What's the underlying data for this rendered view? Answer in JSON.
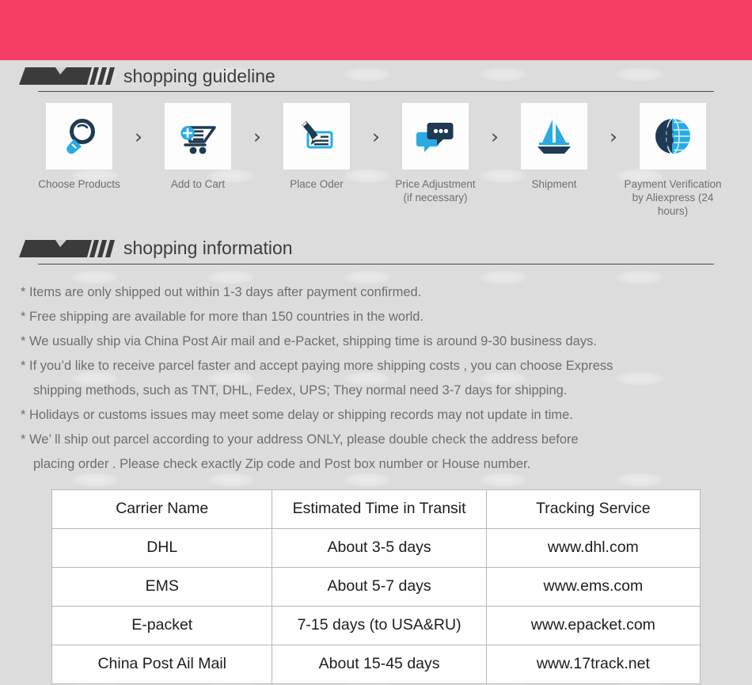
{
  "banner": {
    "color": "#f53e64"
  },
  "sections": {
    "guideline": {
      "title": "shopping guideline"
    },
    "information": {
      "title": "shopping information"
    }
  },
  "steps": [
    {
      "icon": "magnifier-icon",
      "label": "Choose Products"
    },
    {
      "icon": "add-to-cart-icon",
      "label": "Add to Cart"
    },
    {
      "icon": "pen-check-icon",
      "label": "Place Oder"
    },
    {
      "icon": "chat-bubbles-icon",
      "label": "Price Adjustment\n(if necessary)"
    },
    {
      "icon": "sailboat-icon",
      "label": "Shipment"
    },
    {
      "icon": "dollar-globe-icon",
      "label": "Payment Verification\nby  Aliexpress (24 hours)"
    }
  ],
  "step_arrow": "›",
  "information_lines": [
    {
      "text": "* Items are only shipped out within 1-3 days after payment confirmed.",
      "indent": false
    },
    {
      "text": "* Free shipping are available for more than 150 countries in the world.",
      "indent": false
    },
    {
      "text": "* We usually ship via China Post Air mail and e-Packet, shipping time is around 9-30 business days.",
      "indent": false
    },
    {
      "text": "* If you’d like to receive parcel faster and accept paying more shipping costs , you can choose Express",
      "indent": false
    },
    {
      "text": "shipping methods, such as TNT, DHL, Fedex, UPS; They normal need 3-7 days for shipping.",
      "indent": true
    },
    {
      "text": "* Holidays or customs issues may meet some delay or shipping records may not update in time.",
      "indent": false
    },
    {
      "text": "* We’ ll ship out parcel according to your address ONLY, please double check the address before",
      "indent": false
    },
    {
      "text": "placing order . Please check exactly Zip code and Post box number or House number.",
      "indent": true
    }
  ],
  "carrier_table": {
    "headers": [
      "Carrier Name",
      "Estimated Time in Transit",
      "Tracking Service"
    ],
    "rows": [
      [
        "DHL",
        "About 3-5 days",
        "www.dhl.com"
      ],
      [
        "EMS",
        "About 5-7 days",
        "www.ems.com"
      ],
      [
        "E-packet",
        "7-15 days (to USA&RU)",
        "www.epacket.com"
      ],
      [
        "China Post Ail Mail",
        "About 15-45 days",
        "www.17track.net"
      ]
    ]
  },
  "colors": {
    "background": "#dcdcdc",
    "accent_pink": "#f53e64",
    "icon_dark": "#1f3a52",
    "icon_blue": "#29abe2",
    "heading_text": "#3c3c3c",
    "body_text": "#6e6e6e",
    "table_text": "#1d1d1d"
  }
}
